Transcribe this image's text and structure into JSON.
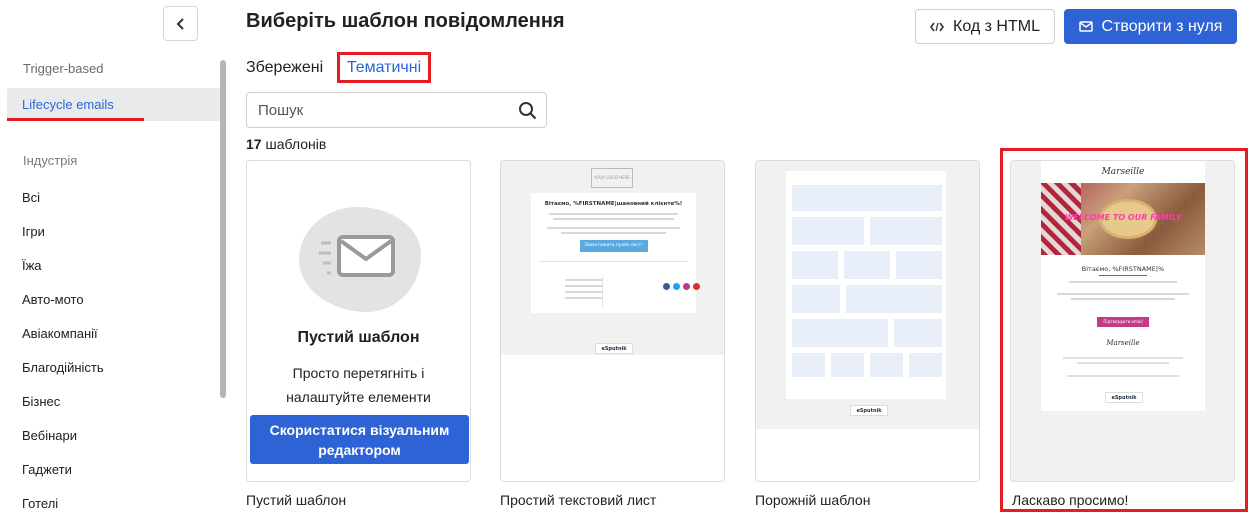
{
  "sidebar": {
    "trigger_based": "Trigger-based",
    "lifecycle": "Lifecycle emails",
    "industry_heading": "Індустрія",
    "categories": [
      "Всі",
      "Ігри",
      "Їжа",
      "Авто-мото",
      "Авіакомпанії",
      "Благодійність",
      "Бізнес",
      "Вебінари",
      "Гаджети",
      "Готелі"
    ]
  },
  "header": {
    "title": "Виберіть шаблон повідомлення",
    "html_button": "Код з HTML",
    "create_button": "Створити з нуля"
  },
  "tabs": {
    "saved": "Збережені",
    "thematic": "Тематичні"
  },
  "search": {
    "placeholder": "Пошук"
  },
  "count": {
    "number": "17",
    "label": "шаблонів"
  },
  "cards": {
    "blank": {
      "title": "Пустий шаблон",
      "description_line1": "Просто перетягніть і",
      "description_line2": "налаштуйте елементи",
      "button_line1": "Скористатися візуальним",
      "button_line2": "редактором",
      "label": "Пустий шаблон"
    },
    "simple_text": {
      "label": "Простий текстовий лист",
      "logo": "YOUR LOGO HERE",
      "greeting": "Вітаємо, %FIRSTNAME|шановний клієнте%!",
      "button": "Завантажити прайс-лист!",
      "brand": "eSputnik"
    },
    "empty": {
      "label": "Порожній шаблон",
      "brand": "eSputnik"
    },
    "welcome": {
      "label": "Ласкаво просимо!",
      "brand_script": "Marseille",
      "banner": "WELCOME TO OUR FAMILY",
      "greeting": "Вітаємо, %FIRSTNAME|%",
      "button": "Підтвердити email",
      "brand": "eSputnik"
    }
  },
  "colors": {
    "accent": "#2d63d4",
    "highlight": "#e51c23",
    "active_link": "#2a67d6"
  }
}
